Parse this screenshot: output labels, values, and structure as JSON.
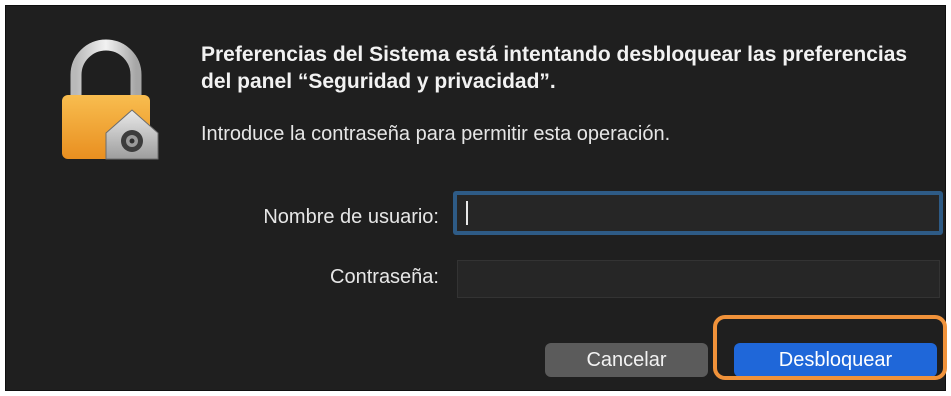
{
  "dialog": {
    "title": "Preferencias del Sistema está intentando desbloquear las preferencias del panel “Seguridad y privacidad”.",
    "message": "Introduce la contraseña para permitir esta operación.",
    "fields": {
      "username_label": "Nombre de usuario:",
      "username_value": "",
      "password_label": "Contraseña:",
      "password_value": ""
    },
    "buttons": {
      "cancel_label": "Cancelar",
      "unlock_label": "Desbloquear"
    },
    "icons": {
      "lock": "lock-icon",
      "badge": "system-preferences-gear-icon"
    }
  },
  "colors": {
    "background": "#1f1f1f",
    "accent": "#1f67d9",
    "focus_ring": "#2e5b86",
    "highlight": "#f0923a",
    "lock_body": "#f5a93a"
  }
}
